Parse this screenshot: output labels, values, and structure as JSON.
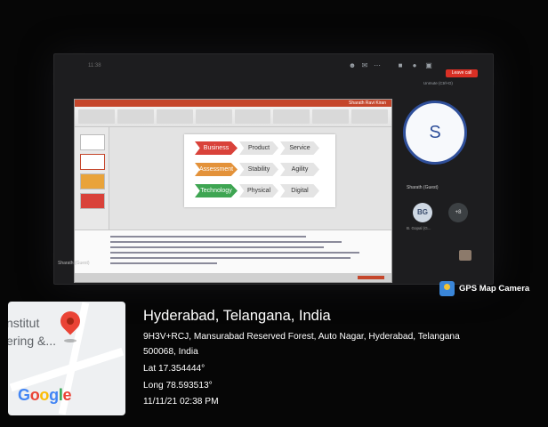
{
  "meet": {
    "clock": "11:38",
    "leave_label": "Leave call",
    "unmute_tooltip": "Unmute (Ctrl+D)",
    "presenter_name": "Sharath (Guest)",
    "tiles": [
      {
        "initial": "S",
        "name": "Sharath (Guest)"
      },
      {
        "initial": "BG",
        "name": "B. Gopal (G..."
      },
      {
        "initial": "+8",
        "name": ""
      }
    ]
  },
  "presentation": {
    "window_title": "Sharath Ravi Kiran",
    "slide_rows": [
      [
        "Business",
        "Product",
        "Service"
      ],
      [
        "Assessment",
        "Stability",
        "Agility"
      ],
      [
        "Technology",
        "Physical",
        "Digital"
      ]
    ],
    "row_colors": [
      "#d9423a",
      "#e3923a",
      "#3ea552"
    ]
  },
  "gps": {
    "brand": "GPS Map Camera",
    "map_labels": [
      "nstitut",
      "ering &..."
    ],
    "google_letters": [
      {
        "ch": "G",
        "color": "#4285f4"
      },
      {
        "ch": "o",
        "color": "#ea4335"
      },
      {
        "ch": "o",
        "color": "#fbbc05"
      },
      {
        "ch": "g",
        "color": "#4285f4"
      },
      {
        "ch": "l",
        "color": "#34a853"
      },
      {
        "ch": "e",
        "color": "#ea4335"
      }
    ],
    "title": "Hyderabad, Telangana, India",
    "address_line1": "9H3V+RCJ, Mansurabad Reserved Forest, Auto Nagar, Hyderabad, Telangana",
    "address_line2": "500068, India",
    "lat": "Lat 17.354444°",
    "long": "Long 78.593513°",
    "datetime": "11/11/21 02:38 PM"
  }
}
